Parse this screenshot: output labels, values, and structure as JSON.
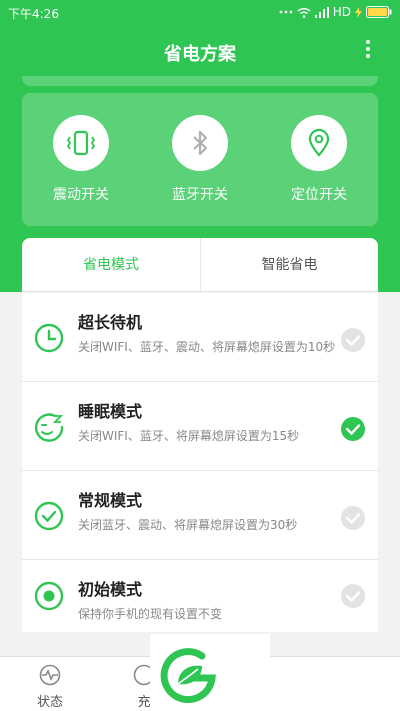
{
  "status_bar": {
    "time": "下午4:26",
    "network": "HD",
    "icons": [
      "dots-icon",
      "wifi-icon",
      "signal-icon",
      "charging-icon",
      "battery-icon"
    ]
  },
  "app_bar": {
    "title": "省电方案",
    "menu_icon": "more-vertical-icon"
  },
  "switches": [
    {
      "label": "震动开关",
      "icon": "vibrate-icon"
    },
    {
      "label": "蓝牙开关",
      "icon": "bluetooth-icon"
    },
    {
      "label": "定位开关",
      "icon": "location-icon"
    }
  ],
  "tabs": [
    {
      "label": "省电模式",
      "active": true
    },
    {
      "label": "智能省电",
      "active": false
    }
  ],
  "modes": [
    {
      "title": "超长待机",
      "desc": "关闭WIFI、蓝牙、震动、将屏幕熄屏设置为10秒",
      "icon": "clock-icon",
      "selected": false
    },
    {
      "title": "睡眠模式",
      "desc": "关闭WIFI、蓝牙、将屏幕熄屏设置为15秒",
      "icon": "sleep-face-icon",
      "selected": true
    },
    {
      "title": "常规模式",
      "desc": "关闭蓝牙、震动、将屏幕熄屏设置为30秒",
      "icon": "check-circle-icon",
      "selected": false
    },
    {
      "title": "初始模式",
      "desc": "保持你手机的现有设置不变",
      "icon": "radio-dot-icon",
      "selected": false
    }
  ],
  "bottom_nav": [
    {
      "label": "状态",
      "icon": "status-icon"
    },
    {
      "label": "充",
      "icon": "charge-icon"
    }
  ],
  "colors": {
    "brand_green": "#2ec553",
    "check_selected": "#2ec553",
    "check_unselected": "#e0e0e0"
  }
}
